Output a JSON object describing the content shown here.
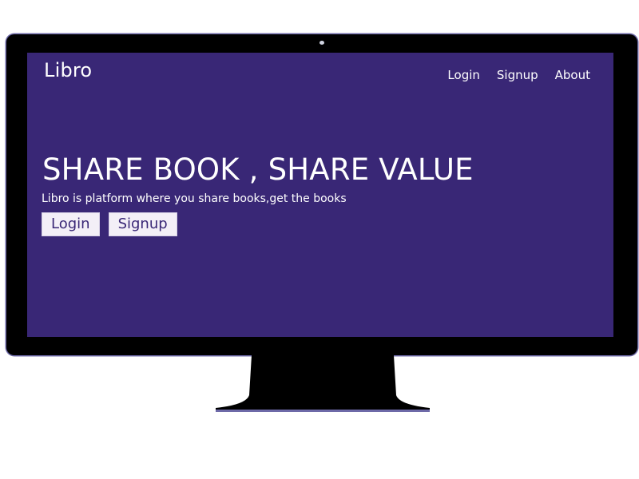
{
  "header": {
    "brand": "Libro",
    "nav": [
      "Login",
      "Signup",
      "About"
    ]
  },
  "hero": {
    "title": "SHARE BOOK , SHARE VALUE",
    "subtitle": "Libro is platform where you share books,get the books",
    "buttons": {
      "login": "Login",
      "signup": "Signup"
    }
  },
  "colors": {
    "screen_background": "#392776",
    "button_background": "#f3eff7",
    "button_text": "#392776",
    "monitor_frame": "#000000"
  },
  "icons": {
    "camera": "camera-icon"
  }
}
